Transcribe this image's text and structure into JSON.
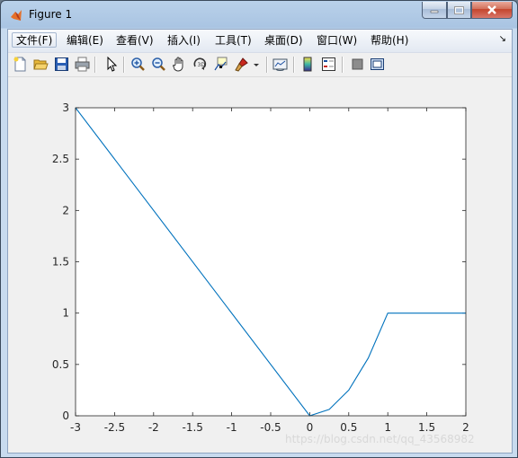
{
  "window": {
    "title": "Figure 1"
  },
  "menu": [
    {
      "label": "文件(F)"
    },
    {
      "label": "编辑(E)"
    },
    {
      "label": "查看(V)"
    },
    {
      "label": "插入(I)"
    },
    {
      "label": "工具(T)"
    },
    {
      "label": "桌面(D)"
    },
    {
      "label": "窗口(W)"
    },
    {
      "label": "帮助(H)"
    }
  ],
  "toolbar": [
    {
      "icon": "new-figure-icon"
    },
    {
      "icon": "open-file-icon"
    },
    {
      "icon": "save-icon"
    },
    {
      "icon": "print-icon"
    },
    {
      "icon": "edit-plot-arrow-icon"
    },
    {
      "icon": "zoom-in-icon"
    },
    {
      "icon": "zoom-out-icon"
    },
    {
      "icon": "pan-hand-icon"
    },
    {
      "icon": "rotate-3d-icon"
    },
    {
      "icon": "data-cursor-icon"
    },
    {
      "icon": "brush-icon"
    },
    {
      "icon": "link-plot-icon"
    },
    {
      "icon": "colorbar-icon"
    },
    {
      "icon": "legend-icon"
    },
    {
      "icon": "hide-plot-tools-icon"
    },
    {
      "icon": "show-plot-tools-icon"
    }
  ],
  "chart_data": {
    "type": "line",
    "series": [
      {
        "x": [
          -3,
          0,
          0.25,
          0.5,
          0.75,
          1,
          2
        ],
        "y": [
          3,
          0,
          0.0625,
          0.25,
          0.5625,
          1,
          1
        ],
        "color": "#0072bd"
      }
    ],
    "xlim": [
      -3,
      2
    ],
    "ylim": [
      0,
      3
    ],
    "xticks": [
      -3,
      -2.5,
      -2,
      -1.5,
      -1,
      -0.5,
      0,
      0.5,
      1,
      1.5,
      2
    ],
    "yticks": [
      0,
      0.5,
      1,
      1.5,
      2,
      2.5,
      3
    ],
    "grid": false,
    "title": "",
    "xlabel": "",
    "ylabel": ""
  },
  "watermark": "https://blog.csdn.net/qq_43568982"
}
